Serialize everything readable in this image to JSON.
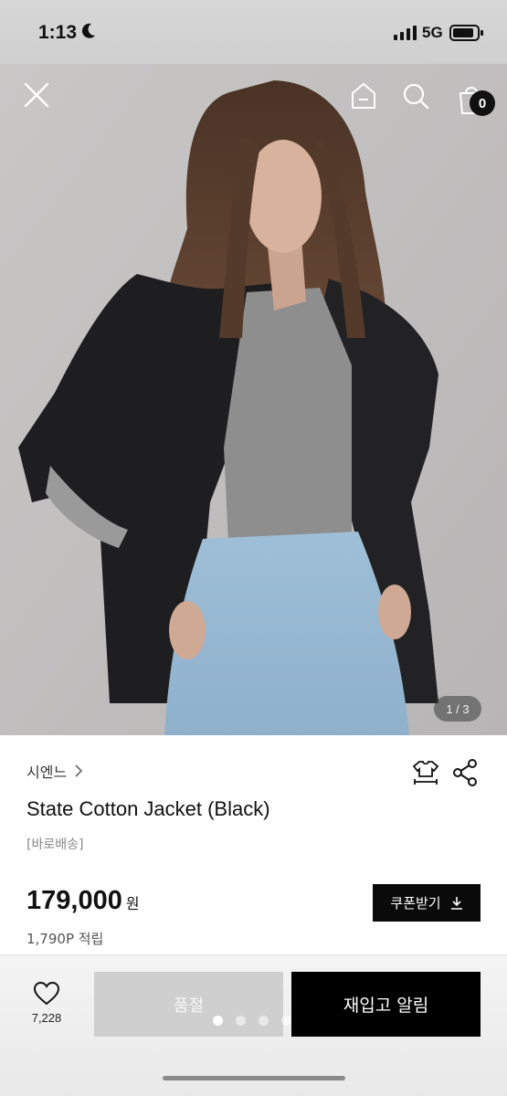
{
  "status_bar": {
    "time": "1:13",
    "network": "5G"
  },
  "hero": {
    "image_counter": "1 / 3",
    "cart_count": "0"
  },
  "product": {
    "brand": "시엔느",
    "name": "State Cotton Jacket (Black)",
    "tag": "[바로배송]",
    "price": "179,000",
    "currency": "원",
    "points": "1,790P 적립",
    "coupon_label": "쿠폰받기"
  },
  "bottom_bar": {
    "like_count": "7,228",
    "sold_out_label": "품절",
    "restock_label": "재입고 알림"
  },
  "icons": [
    "close-icon",
    "home-icon",
    "search-icon",
    "cart-icon",
    "chevron-right-icon",
    "size-guide-icon",
    "share-icon",
    "download-icon",
    "heart-icon"
  ],
  "colors": {
    "primary_button": "#000000",
    "disabled_button": "#cfcfcf",
    "badge": "#111111"
  }
}
